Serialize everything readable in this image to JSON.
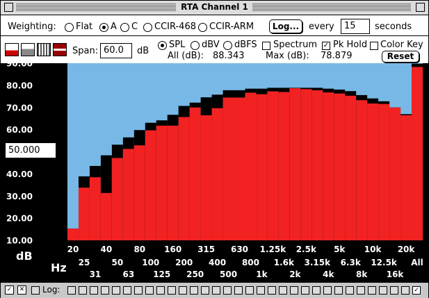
{
  "window": {
    "title": "RTA Channel 1"
  },
  "weighting": {
    "label": "Weighting:",
    "options": [
      "Flat",
      "A",
      "C",
      "CCIR-468",
      "CCIR-ARM"
    ],
    "selected": "A"
  },
  "log_button": "Log...",
  "every_label": "every",
  "every_value": "15",
  "seconds_label": "seconds",
  "span": {
    "label": "Span:",
    "value": "60.0",
    "unit": "dB"
  },
  "modes": {
    "options": [
      "SPL",
      "dBV",
      "dBFS"
    ],
    "selected": "SPL"
  },
  "all_db": {
    "label": "All (dB):",
    "value": "88.343"
  },
  "max_db": {
    "label": "Max (dB):",
    "value": "78.879"
  },
  "checkboxes": {
    "spectrum": {
      "label": "Spectrum",
      "checked": false
    },
    "pk_hold": {
      "label": "Pk Hold",
      "checked": true
    },
    "color_key": {
      "label": "Color Key",
      "checked": false
    }
  },
  "reset_button": "Reset",
  "reference_field": "50.000",
  "y_unit": "dB",
  "x_unit": "Hz",
  "bottom_bar": {
    "log_label": "Log:"
  },
  "colors": {
    "bar": "#f22222",
    "peak": "#000000",
    "background_fill": "#78b8e6"
  },
  "chart_data": {
    "type": "bar",
    "ylim": [
      10,
      90
    ],
    "y_ticks": [
      "90.00",
      "80.00",
      "70.00",
      "60.00",
      "50.00",
      "40.00",
      "30.00",
      "20.00",
      "10.00"
    ],
    "categories": [
      "20",
      "25",
      "31",
      "40",
      "50",
      "63",
      "80",
      "100",
      "125",
      "160",
      "200",
      "250",
      "315",
      "400",
      "500",
      "630",
      "800",
      "1k",
      "1.25k",
      "1.6k",
      "2k",
      "2.5k",
      "3.15k",
      "4k",
      "5k",
      "6.3k",
      "8k",
      "10k",
      "12.5k",
      "16k",
      "20k",
      "All"
    ],
    "x_labels_row1": [
      "20",
      "40",
      "80",
      "160",
      "315",
      "630",
      "1.25k",
      "2.5k",
      "5k",
      "10k",
      "20k"
    ],
    "x_labels_row2": [
      "25",
      "50",
      "100",
      "200",
      "400",
      "800",
      "1.6k",
      "3.15k",
      "6.3k",
      "12.5k",
      "All"
    ],
    "x_labels_row3": [
      "31",
      "63",
      "125",
      "250",
      "500",
      "1k",
      "2k",
      "4k",
      "8k",
      "16k"
    ],
    "series": [
      {
        "values": [
          15.3,
          33.8,
          38.5,
          31.4,
          47.2,
          51.3,
          52.9,
          59.7,
          61.8,
          61.8,
          65.7,
          70.0,
          66.5,
          69.7,
          74.5,
          74.5,
          76.7,
          76.0,
          77.3,
          77.0,
          78.7,
          78.3,
          77.8,
          76.8,
          76.3,
          75.3,
          73.3,
          71.8,
          71.6,
          70.0,
          66.5,
          88.3
        ]
      },
      {
        "values": [
          15.3,
          38.9,
          43.6,
          48.4,
          53.2,
          56.5,
          59.8,
          63.1,
          64.2,
          66.7,
          70.7,
          72.2,
          74.6,
          75.8,
          77.8,
          77.8,
          78.5,
          78.5,
          78.9,
          78.9,
          78.9,
          78.9,
          78.9,
          78.5,
          78.1,
          77.4,
          75.6,
          74.1,
          72.8,
          70.0,
          67.0,
          89.8
        ]
      }
    ]
  }
}
